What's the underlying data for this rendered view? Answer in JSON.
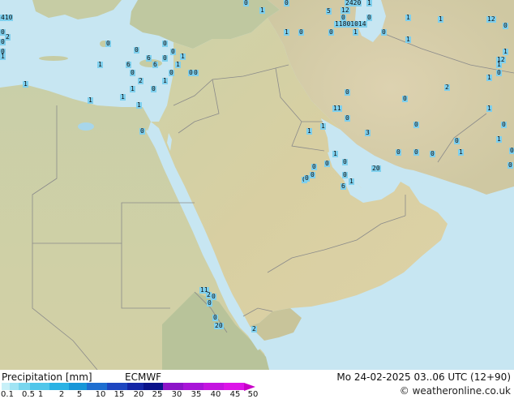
{
  "footer": {
    "legend_title": "Precipitation [mm]",
    "model": "ECMWF",
    "valid_time": "Mo 24-02-2025 03..06 UTC (12+90)",
    "credit": "© weatheronline.co.uk",
    "credit_icon": "copyright-icon"
  },
  "colorbar": {
    "ticks": [
      "0.1",
      "0.5",
      "1",
      "2",
      "5",
      "10",
      "15",
      "20",
      "25",
      "30",
      "35",
      "40",
      "45",
      "50"
    ],
    "colors": [
      "#c8f0f8",
      "#a0e4f4",
      "#78d6ee",
      "#50c6ea",
      "#2ab2e4",
      "#1696d8",
      "#1e6ed0",
      "#1e46c0",
      "#1426a6",
      "#0a128a",
      "#8c14c8",
      "#a814d8",
      "#c414e0",
      "#dc14e8",
      "#c800c8"
    ]
  },
  "map_labels": [
    {
      "text": "410",
      "cls": "w"
    },
    {
      "text": "1",
      "cls": "w"
    },
    {
      "text": "5",
      "cls": "w"
    },
    {
      "text": "12",
      "cls": "w"
    },
    {
      "text": "20",
      "cls": "w"
    },
    {
      "text": "1",
      "cls": "w"
    },
    {
      "text": "2420",
      "cls": "w"
    },
    {
      "text": "1",
      "cls": "w"
    },
    {
      "text": "0",
      "cls": "w"
    },
    {
      "text": "0",
      "cls": "w"
    },
    {
      "text": "1",
      "cls": "w"
    },
    {
      "text": "0",
      "cls": "w"
    },
    {
      "text": "1",
      "cls": "w"
    },
    {
      "text": "0",
      "cls": "w"
    },
    {
      "text": "1",
      "cls": "w"
    },
    {
      "text": "11801014",
      "cls": "w"
    },
    {
      "text": "0",
      "cls": "w"
    },
    {
      "text": "1",
      "cls": "w"
    },
    {
      "text": "12",
      "cls": "w"
    },
    {
      "text": "0",
      "cls": "w"
    },
    {
      "text": "0",
      "cls": "w"
    },
    {
      "text": "0",
      "cls": "w"
    },
    {
      "text": "1",
      "cls": "w"
    },
    {
      "text": "0",
      "cls": "w"
    },
    {
      "text": "0",
      "cls": "w"
    },
    {
      "text": "0",
      "cls": "w"
    },
    {
      "text": "0",
      "cls": "w"
    },
    {
      "text": "0",
      "cls": "w"
    },
    {
      "text": "6",
      "cls": "w"
    },
    {
      "text": "6",
      "cls": "w"
    },
    {
      "text": "6",
      "cls": "w"
    },
    {
      "text": "1",
      "cls": "w"
    },
    {
      "text": "1",
      "cls": "w"
    },
    {
      "text": "12",
      "cls": "w"
    },
    {
      "text": "1",
      "cls": "w"
    },
    {
      "text": "0",
      "cls": "w"
    },
    {
      "text": "1",
      "cls": "w"
    },
    {
      "text": "2",
      "cls": "w"
    },
    {
      "text": "0",
      "cls": "w"
    },
    {
      "text": "0",
      "cls": "w"
    },
    {
      "text": "11",
      "cls": "w"
    },
    {
      "text": "0",
      "cls": "w"
    },
    {
      "text": "1",
      "cls": "w"
    },
    {
      "text": "1",
      "cls": "w"
    },
    {
      "text": "3",
      "cls": "w"
    },
    {
      "text": "0",
      "cls": "w"
    },
    {
      "text": "0",
      "cls": "w"
    },
    {
      "text": "1",
      "cls": "w"
    },
    {
      "text": "0",
      "cls": "w"
    },
    {
      "text": "0",
      "cls": "w"
    },
    {
      "text": "20",
      "cls": "w"
    },
    {
      "text": "0",
      "cls": "w"
    },
    {
      "text": "0",
      "cls": "w"
    },
    {
      "text": "0",
      "cls": "w"
    },
    {
      "text": "0",
      "cls": "w"
    },
    {
      "text": "0",
      "cls": "w"
    },
    {
      "text": "1",
      "cls": "w"
    },
    {
      "text": "6",
      "cls": "w"
    },
    {
      "text": "11",
      "cls": "w"
    },
    {
      "text": "2",
      "cls": "w"
    },
    {
      "text": "0",
      "cls": "w"
    },
    {
      "text": "0",
      "cls": "w"
    },
    {
      "text": "20",
      "cls": "w"
    },
    {
      "text": "2",
      "cls": "w"
    },
    {
      "text": "1",
      "cls": "w"
    },
    {
      "text": "0",
      "cls": "w"
    },
    {
      "text": "0",
      "cls": "w"
    },
    {
      "text": "0",
      "cls": "w"
    },
    {
      "text": "0",
      "cls": "w"
    },
    {
      "text": "0",
      "cls": "w"
    },
    {
      "text": "2",
      "cls": "w"
    },
    {
      "text": "1",
      "cls": "w"
    },
    {
      "text": "1",
      "cls": "w"
    },
    {
      "text": "1",
      "cls": "w"
    },
    {
      "text": "0",
      "cls": "w"
    },
    {
      "text": "1",
      "cls": "w"
    },
    {
      "text": "0",
      "cls": "w"
    },
    {
      "text": "1",
      "cls": "w"
    },
    {
      "text": "1",
      "cls": "w"
    },
    {
      "text": "0",
      "cls": "w"
    },
    {
      "text": "0",
      "cls": "w"
    },
    {
      "text": "1",
      "cls": "w"
    },
    {
      "text": "1",
      "cls": "w"
    },
    {
      "text": "0",
      "cls": "w"
    },
    {
      "text": "2",
      "cls": "w"
    },
    {
      "text": "0",
      "cls": "w"
    },
    {
      "text": "0",
      "cls": "w"
    },
    {
      "text": "0",
      "cls": "w"
    },
    {
      "text": "1",
      "cls": "w"
    },
    {
      "text": "0",
      "cls": "w"
    },
    {
      "text": "0",
      "cls": "w"
    },
    {
      "text": "1",
      "cls": "w"
    },
    {
      "text": "0",
      "cls": "w"
    }
  ]
}
